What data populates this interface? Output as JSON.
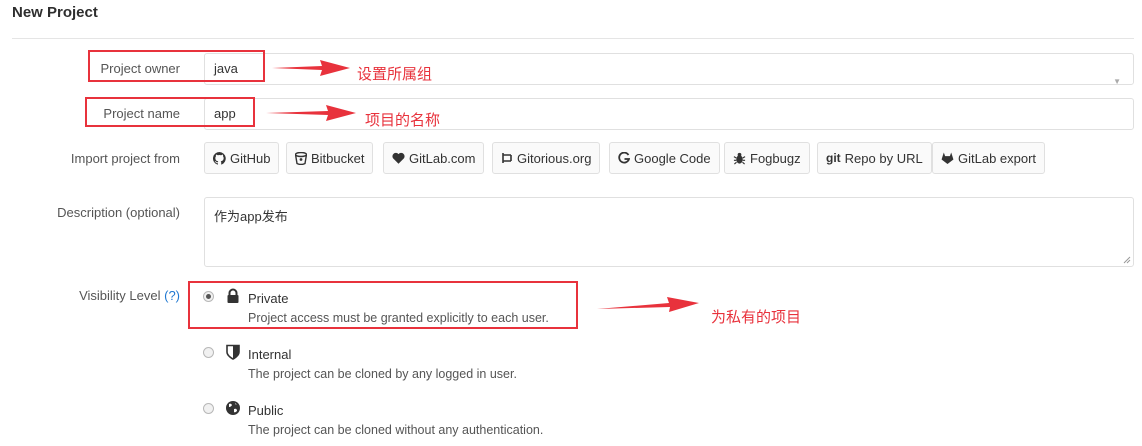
{
  "page": {
    "title": "New Project"
  },
  "form": {
    "owner": {
      "label": "Project owner",
      "value": "java"
    },
    "name": {
      "label": "Project name",
      "value": "app"
    },
    "import": {
      "label": "Import project from",
      "sources": [
        {
          "label": "GitHub",
          "icon": "github-icon"
        },
        {
          "label": "Bitbucket",
          "icon": "bitbucket-icon"
        },
        {
          "label": "GitLab.com",
          "icon": "heart-icon"
        },
        {
          "label": "Gitorious.org",
          "icon": "gitorious-icon"
        },
        {
          "label": "Google Code",
          "icon": "google-icon"
        },
        {
          "label": "Fogbugz",
          "icon": "bug-icon"
        },
        {
          "label": "Repo by URL",
          "prefix": "git",
          "icon": "git-icon"
        },
        {
          "label": "GitLab export",
          "icon": "gitlab-icon"
        }
      ]
    },
    "description": {
      "label": "Description (optional)",
      "value": "作为app发布"
    },
    "visibility": {
      "label": "Visibility Level",
      "help": "(?)",
      "options": [
        {
          "title": "Private",
          "desc": "Project access must be granted explicitly to each user.",
          "icon": "lock-icon",
          "checked": true
        },
        {
          "title": "Internal",
          "desc": "The project can be cloned by any logged in user.",
          "icon": "shield-icon",
          "checked": false
        },
        {
          "title": "Public",
          "desc": "The project can be cloned without any authentication.",
          "icon": "globe-icon",
          "checked": false
        }
      ]
    }
  },
  "annotations": {
    "color": "#e8323c",
    "owner": "设置所属组",
    "name": "项目的名称",
    "visibility": "为私有的项目"
  }
}
